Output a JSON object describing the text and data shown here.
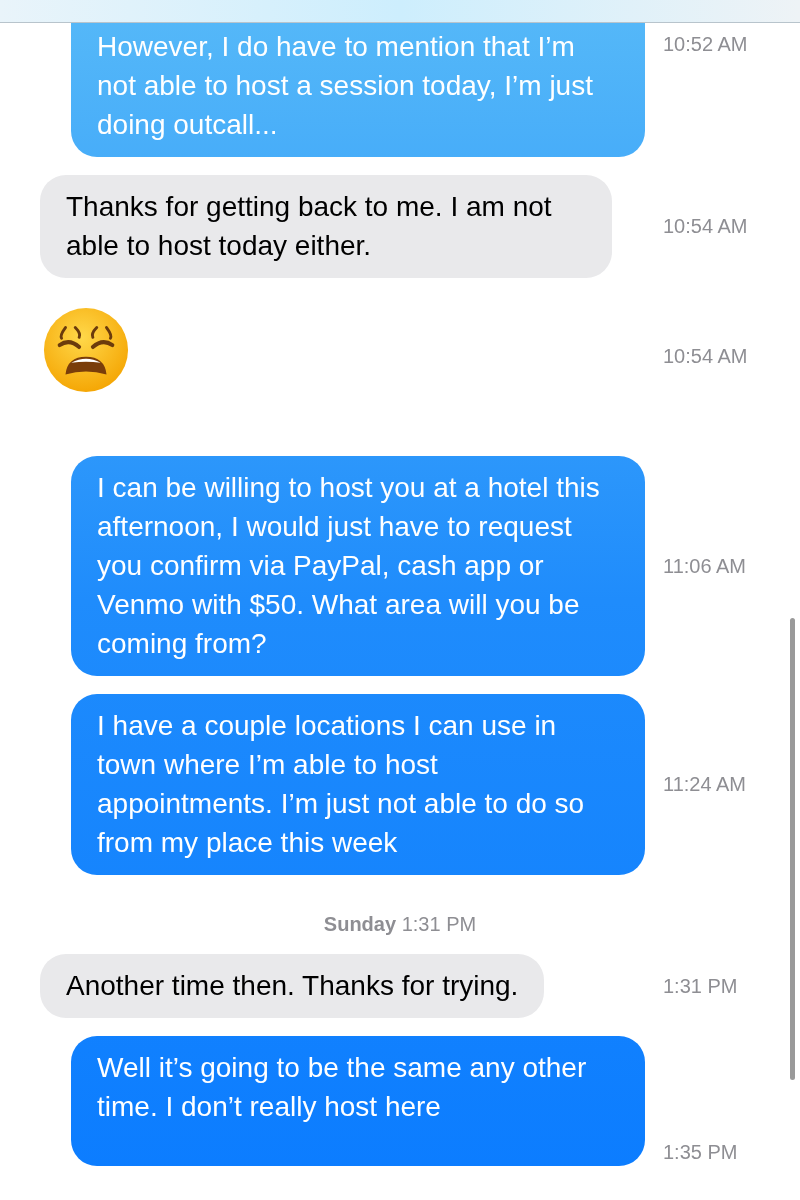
{
  "messages": [
    {
      "kind": "sent",
      "text": "However, I do have to mention that I’m not able to host a session today, I’m just doing outcall...",
      "time": "10:52 AM"
    },
    {
      "kind": "received",
      "text": "Thanks for getting back to me. I am not able to host today either.",
      "time": "10:54 AM"
    },
    {
      "kind": "emoji",
      "time": "10:54 AM"
    },
    {
      "kind": "sent",
      "text": "I can be willing to host you at a hotel this afternoon, I would just have to request you confirm via PayPal, cash app or Venmo with $50. What area will you be coming from?",
      "time": "11:06 AM"
    },
    {
      "kind": "sent",
      "text": "I have a couple locations I can use in town where I’m able to host appointments. I’m just not able to do so from my place this week",
      "time": "11:24 AM"
    },
    {
      "kind": "day",
      "day": "Sunday",
      "time": "1:31 PM"
    },
    {
      "kind": "received",
      "text": "Another time then. Thanks for trying.",
      "time": "1:31 PM"
    },
    {
      "kind": "sent",
      "text": "Well it’s going to be the same any other time. I don’t really host here",
      "time": "1:35 PM"
    }
  ]
}
